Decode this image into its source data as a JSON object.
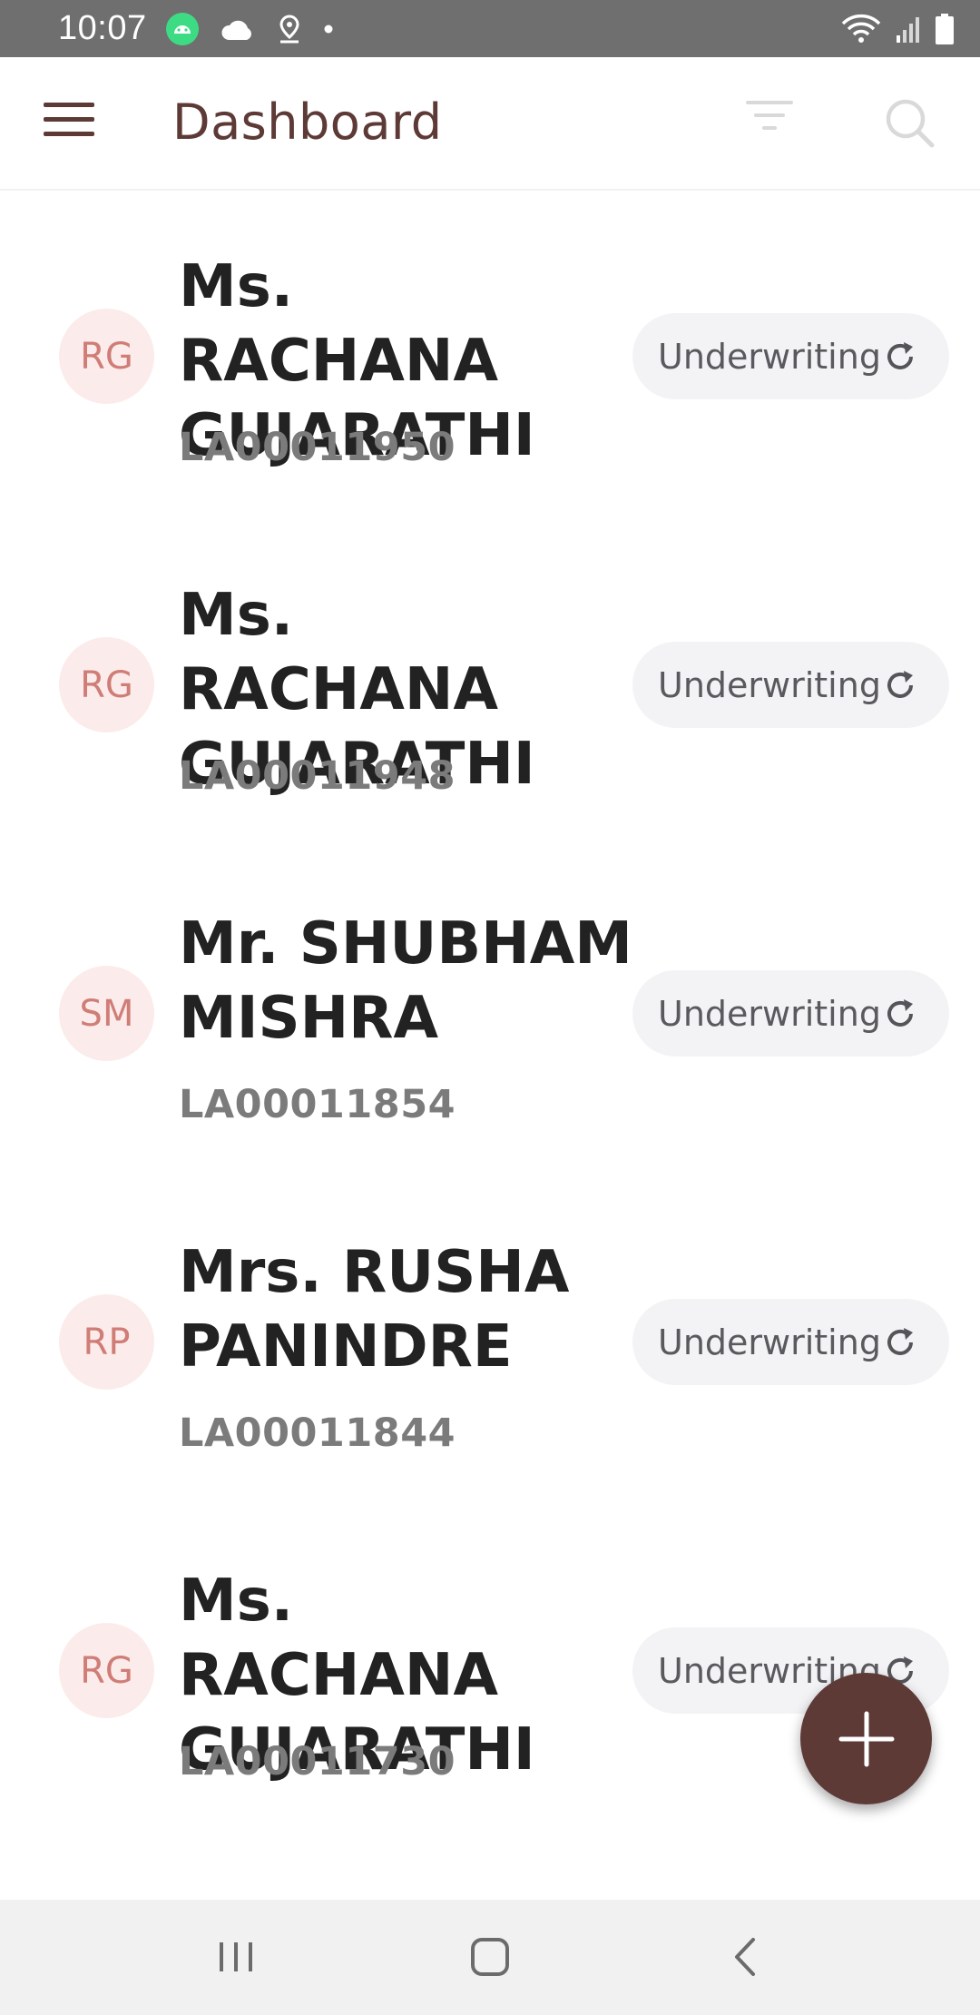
{
  "status_bar": {
    "time": "10:07",
    "left_icons": [
      "android-icon",
      "cloud-icon",
      "location-icon",
      "dot-icon"
    ],
    "right_icons": [
      "wifi-icon",
      "signal-icon",
      "battery-icon"
    ]
  },
  "app_bar": {
    "title": "Dashboard",
    "menu_icon": "menu-icon",
    "filter_icon": "filter-icon",
    "search_icon": "search-icon"
  },
  "list": {
    "items": [
      {
        "initials": "RG",
        "name_line1": "Ms. RACHANA",
        "name_line2": "GUJARATHI",
        "policy_no": "LA00011950",
        "status": "Underwriting"
      },
      {
        "initials": "RG",
        "name_line1": "Ms. RACHANA",
        "name_line2": "GUJARATHI",
        "policy_no": "LA00011948",
        "status": "Underwriting"
      },
      {
        "initials": "SM",
        "name_line1": "Mr. SHUBHAM",
        "name_line2": "MISHRA",
        "policy_no": "LA00011854",
        "status": "Underwriting"
      },
      {
        "initials": "RP",
        "name_line1": "Mrs. RUSHA",
        "name_line2": "PANINDRE",
        "policy_no": "LA00011844",
        "status": "Underwriting"
      },
      {
        "initials": "RG",
        "name_line1": "Ms. RACHANA",
        "name_line2": "GUJARATHI",
        "policy_no": "LA00011730",
        "status": "Underwriting"
      }
    ]
  },
  "fab": {
    "icon": "plus-icon"
  },
  "nav_bar": {
    "icons": [
      "recents-icon",
      "home-icon",
      "back-icon"
    ]
  },
  "colors": {
    "brand": "#5d3a36",
    "avatar_bg": "#fbeceb",
    "avatar_text": "#d07d77",
    "chip_bg": "#f3f3f6",
    "status_bar": "#6f6f6f"
  }
}
